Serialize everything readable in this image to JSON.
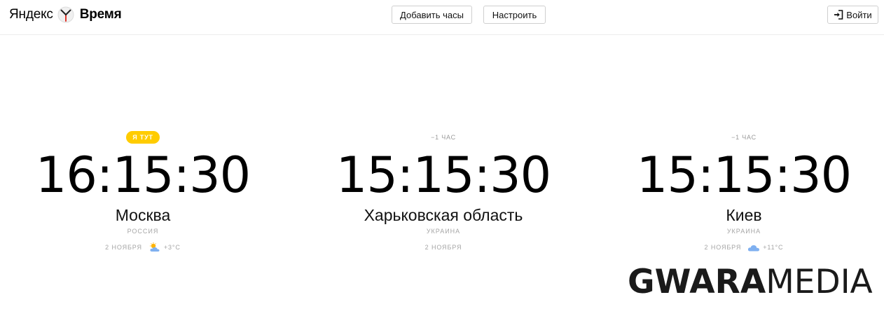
{
  "header": {
    "logo_brand": "Яндекс",
    "logo_service": "Время",
    "add_clock_label": "Добавить часы",
    "settings_label": "Настроить",
    "login_label": "Войти",
    "login_icon": "login-icon"
  },
  "clocks": [
    {
      "badge": "Я ТУТ",
      "time": "16:15:30",
      "city": "Москва",
      "country": "РОССИЯ",
      "date": "2 НОЯБРЯ",
      "weather_icon": "partly-cloudy-icon",
      "temperature": "+3°C"
    },
    {
      "offset": "−1 ЧАС",
      "time": "15:15:30",
      "city": "Харьковская область",
      "country": "УКРАИНА",
      "date": "2 НОЯБРЯ"
    },
    {
      "offset": "−1 ЧАС",
      "time": "15:15:30",
      "city": "Киев",
      "country": "УКРАИНА",
      "date": "2 НОЯБРЯ",
      "weather_icon": "cloud-icon",
      "temperature": "+11°C"
    }
  ],
  "watermark": {
    "part1": "GWARA",
    "part2": "MEDIA"
  },
  "colors": {
    "badge": "#ffcc00",
    "muted_text": "#a5a5a5",
    "border": "#cfcfcf",
    "cloud": "#7fb0f0",
    "sun": "#ffb300"
  }
}
